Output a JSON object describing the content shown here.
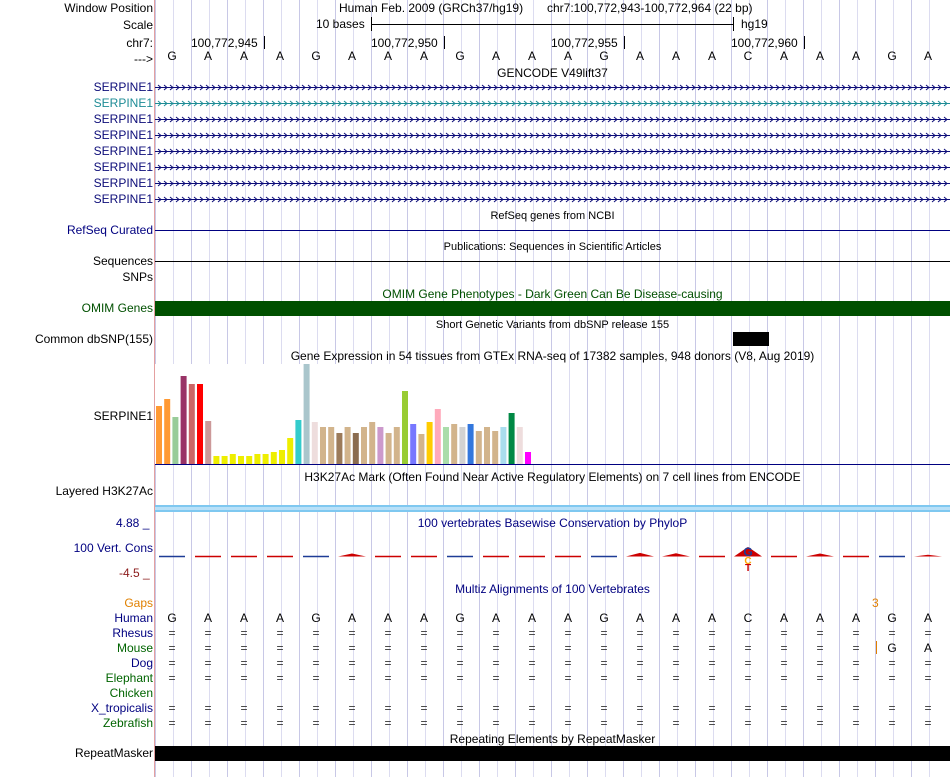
{
  "header": {
    "window_position_label": "Window Position",
    "assembly": "Human Feb. 2009 (GRCh37/hg19)",
    "position": "chr7:100,772,943-100,772,964 (22 bp)",
    "scale_label": "Scale",
    "scale_text": "10 bases",
    "scale_db": "hg19",
    "chrom_label": "chr7:",
    "strand_label": "--->",
    "ticks": [
      "100,772,945",
      "100,772,950",
      "100,772,955",
      "100,772,960"
    ]
  },
  "bases": [
    "G",
    "A",
    "A",
    "A",
    "G",
    "A",
    "A",
    "A",
    "G",
    "A",
    "A",
    "A",
    "G",
    "A",
    "A",
    "A",
    "C",
    "A",
    "A",
    "A",
    "G",
    "A"
  ],
  "tracks": {
    "gencode": {
      "title": "GENCODE V49lift37",
      "genes": [
        "SERPINE1",
        "SERPINE1",
        "SERPINE1",
        "SERPINE1",
        "SERPINE1",
        "SERPINE1",
        "SERPINE1",
        "SERPINE1"
      ],
      "colors": [
        "#0c0c78",
        "#1e8c96",
        "#0c0c78",
        "#0c0c78",
        "#0c0c78",
        "#0c0c78",
        "#0c0c78",
        "#0c0c78"
      ]
    },
    "refseq": {
      "title": "RefSeq genes from NCBI",
      "label": "RefSeq Curated"
    },
    "publications": {
      "title": "Publications: Sequences in Scientific Articles",
      "label1": "Sequences",
      "label2": "SNPs"
    },
    "omim": {
      "title": "OMIM Gene Phenotypes - Dark Green Can Be Disease-causing",
      "label": "OMIM Genes",
      "color": "#005000"
    },
    "dbsnp": {
      "title": "Short Genetic Variants from dbSNP release 155",
      "label": "Common dbSNP(155)"
    },
    "gtex": {
      "title": "Gene Expression in 54 tissues from GTEx RNA-seq of 17382 samples, 948 donors (V8, Aug 2019)",
      "label": "SERPINE1",
      "bar_heights": [
        58,
        65,
        47,
        88,
        80,
        80,
        43,
        8,
        8,
        10,
        8,
        8,
        10,
        10,
        12,
        14,
        26,
        44,
        100,
        42,
        37,
        37,
        31,
        37,
        31,
        37,
        42,
        37,
        31,
        37,
        73,
        40,
        30,
        42,
        55,
        37,
        40,
        37,
        40,
        33,
        37,
        33,
        37,
        51,
        37,
        12
      ],
      "bar_colors": [
        "#ff9933",
        "#ff9933",
        "#99cc99",
        "#993366",
        "#cc6666",
        "#ff0000",
        "#cc9999",
        "#eeee00",
        "#eeee00",
        "#eeee00",
        "#eeee00",
        "#eeee00",
        "#eeee00",
        "#eeee00",
        "#eeee00",
        "#eeee00",
        "#eeee00",
        "#33cccc",
        "#aac6cc",
        "#eedddd",
        "#d2b48c",
        "#d2b48c",
        "#9c7b5a",
        "#d2b48c",
        "#8b6c4f",
        "#d2b48c",
        "#d2b48c",
        "#cc99cc",
        "#d2b48c",
        "#d2b48c",
        "#99cc33",
        "#7777ff",
        "#d2b48c",
        "#ffcc00",
        "#ffaabb",
        "#aaddaa",
        "#d2b48c",
        "#d2d2d2",
        "#3377dd",
        "#d2b48c",
        "#d2b48c",
        "#d2b48c",
        "#aaddee",
        "#008844",
        "#eedddd",
        "#ff00ff"
      ]
    },
    "h3k27ac": {
      "title": "H3K27Ac Mark (Often Found Near Active Regulatory Elements) on 7 cell lines from ENCODE",
      "label": "Layered H3K27Ac"
    },
    "phylop": {
      "title": "100 vertebrates Basewise Conservation by PhyloP",
      "label": "100 Vert. Cons",
      "max": "4.88 _",
      "min": "-4.5 _"
    },
    "multiz": {
      "title": "Multiz Alignments of 100 Vertebrates",
      "gaps_label": "Gaps",
      "gap_count": "3",
      "species": [
        {
          "name": "Human",
          "color": "#000080"
        },
        {
          "name": "Rhesus",
          "color": "#000080"
        },
        {
          "name": "Mouse",
          "color": "#006400"
        },
        {
          "name": "Dog",
          "color": "#000080"
        },
        {
          "name": "Elephant",
          "color": "#006400"
        },
        {
          "name": "Chicken",
          "color": "#006400"
        },
        {
          "name": "X_tropicalis",
          "color": "#000080"
        },
        {
          "name": "Zebrafish",
          "color": "#006400"
        }
      ],
      "mouse_tail": [
        "G",
        "A"
      ]
    },
    "repeatmasker": {
      "title": "Repeating Elements by RepeatMasker",
      "label": "RepeatMasker"
    }
  }
}
